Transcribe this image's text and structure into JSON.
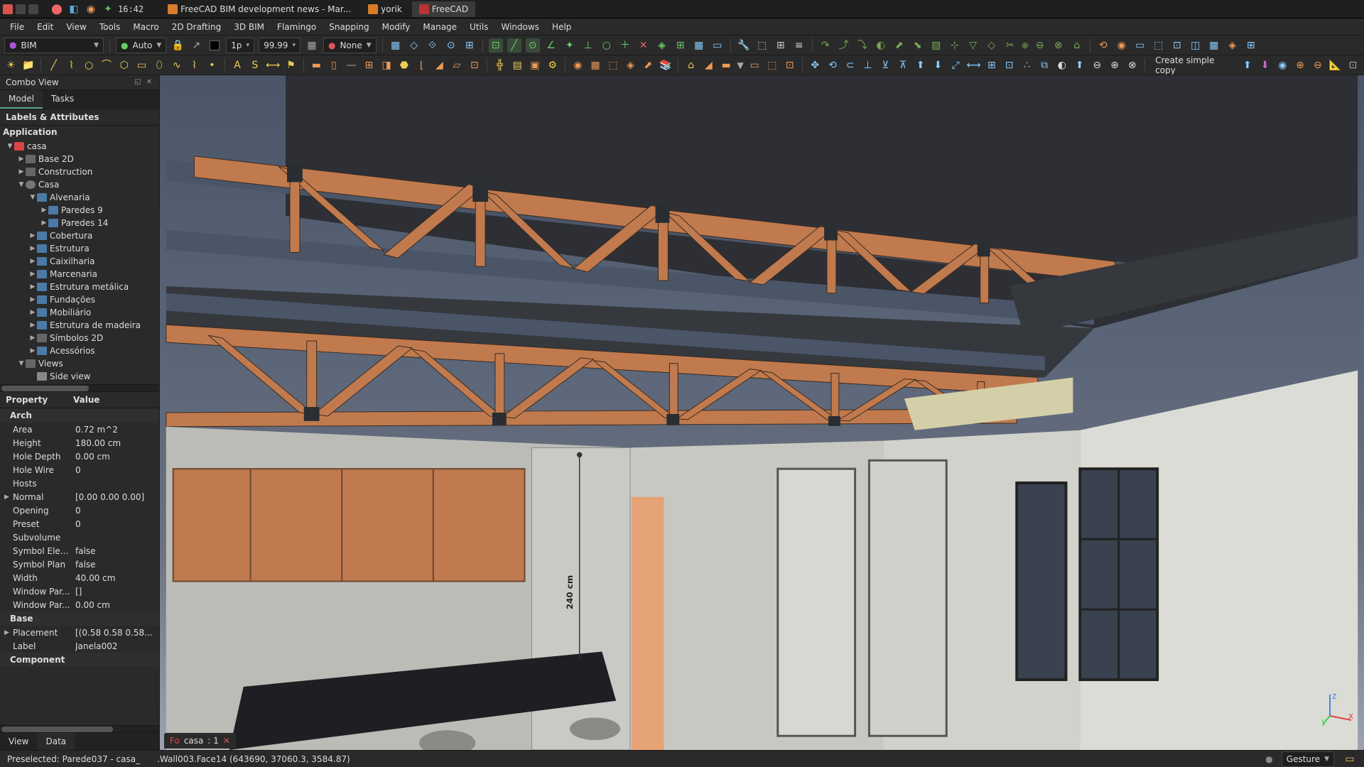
{
  "os_titlebar": {
    "clock": "16:42",
    "tabs": [
      {
        "icon": "#d97c2b",
        "label": "FreeCAD BIM development news - Mar..."
      },
      {
        "icon": "#d97c2b",
        "label": "yorik"
      },
      {
        "icon": "#b33",
        "label": "FreeCAD",
        "active": true
      }
    ]
  },
  "menus": [
    "File",
    "Edit",
    "View",
    "Tools",
    "Macro",
    "2D Drafting",
    "3D BIM",
    "Flamingo",
    "Snapping",
    "Modify",
    "Manage",
    "Utils",
    "Windows",
    "Help"
  ],
  "toolbar1": {
    "workbench": "BIM",
    "auto_label": "Auto",
    "lock_icon": "•",
    "step_label": "1p",
    "step_value": "99.99",
    "none_label": "None"
  },
  "toolbar3": {
    "copy_label": "Create simple copy"
  },
  "combo_view": {
    "title": "Combo View",
    "tabs": {
      "model": "Model",
      "tasks": "Tasks"
    },
    "tree_header": "Labels & Attributes",
    "application": "Application"
  },
  "tree": [
    {
      "depth": 0,
      "exp": "▼",
      "icon": "doc",
      "label": "casa"
    },
    {
      "depth": 1,
      "exp": "▶",
      "icon": "folder-grey",
      "label": "Base 2D",
      "dim": true
    },
    {
      "depth": 1,
      "exp": "▶",
      "icon": "folder-grey",
      "label": "Construction",
      "dim": true
    },
    {
      "depth": 1,
      "exp": "▼",
      "icon": "group",
      "label": "Casa"
    },
    {
      "depth": 2,
      "exp": "▼",
      "icon": "folder-blue",
      "label": "Alvenaria"
    },
    {
      "depth": 3,
      "exp": "▶",
      "icon": "folder-blue",
      "label": "Paredes 9"
    },
    {
      "depth": 3,
      "exp": "▶",
      "icon": "folder-blue",
      "label": "Paredes 14"
    },
    {
      "depth": 2,
      "exp": "▶",
      "icon": "folder-blue",
      "label": "Cobertura"
    },
    {
      "depth": 2,
      "exp": "▶",
      "icon": "folder-blue",
      "label": "Estrutura"
    },
    {
      "depth": 2,
      "exp": "▶",
      "icon": "folder-blue",
      "label": "Caixilharia"
    },
    {
      "depth": 2,
      "exp": "▶",
      "icon": "folder-blue",
      "label": "Marcenaria"
    },
    {
      "depth": 2,
      "exp": "▶",
      "icon": "folder-blue",
      "label": "Estrutura metálica"
    },
    {
      "depth": 2,
      "exp": "▶",
      "icon": "folder-blue",
      "label": "Fundações"
    },
    {
      "depth": 2,
      "exp": "▶",
      "icon": "folder-blue",
      "label": "Mobiliário"
    },
    {
      "depth": 2,
      "exp": "▶",
      "icon": "folder-blue",
      "label": "Estrutura de madeira"
    },
    {
      "depth": 2,
      "exp": "▶",
      "icon": "folder-grey",
      "label": "Símbolos 2D",
      "dim": true
    },
    {
      "depth": 2,
      "exp": "▶",
      "icon": "folder-blue",
      "label": "Acessórios"
    },
    {
      "depth": 1,
      "exp": "▼",
      "icon": "folder-grey",
      "label": "Views",
      "dim": true
    },
    {
      "depth": 2,
      "exp": "",
      "icon": "page",
      "label": "Side view",
      "dim": true
    }
  ],
  "props_header": {
    "prop": "Property",
    "val": "Value"
  },
  "props": [
    {
      "group": "Arch"
    },
    {
      "name": "Area",
      "value": "0.72 m^2"
    },
    {
      "name": "Height",
      "value": "180.00 cm"
    },
    {
      "name": "Hole Depth",
      "value": "0.00 cm"
    },
    {
      "name": "Hole Wire",
      "value": "0"
    },
    {
      "name": "Hosts",
      "value": ""
    },
    {
      "name": "Normal",
      "value": "[0.00 0.00 0.00]",
      "exp": "▶"
    },
    {
      "name": "Opening",
      "value": "0"
    },
    {
      "name": "Preset",
      "value": "0"
    },
    {
      "name": "Subvolume",
      "value": ""
    },
    {
      "name": "Symbol Ele...",
      "value": "false"
    },
    {
      "name": "Symbol Plan",
      "value": "false"
    },
    {
      "name": "Width",
      "value": "40.00 cm"
    },
    {
      "name": "Window Par...",
      "value": "[]"
    },
    {
      "name": "Window Par...",
      "value": "0.00 cm"
    },
    {
      "group": "Base"
    },
    {
      "name": "Placement",
      "value": "[(0.58 0.58 0.58...",
      "exp": "▶"
    },
    {
      "name": "Label",
      "value": "Janela002"
    },
    {
      "group": "Component"
    }
  ],
  "bottom_tabs": {
    "view": "View",
    "data": "Data"
  },
  "document_tab": {
    "name": "casa",
    "suffix": ": 1"
  },
  "viewport": {
    "dimension": "240 cm"
  },
  "status": {
    "preselected": "Preselected: Parede037 - casa_",
    "hit": ".Wall003.Face14 (643690, 37060.3, 3584.87)",
    "nav_mode": "Gesture"
  },
  "axes": {
    "x": "x",
    "y": "y",
    "z": "z"
  }
}
